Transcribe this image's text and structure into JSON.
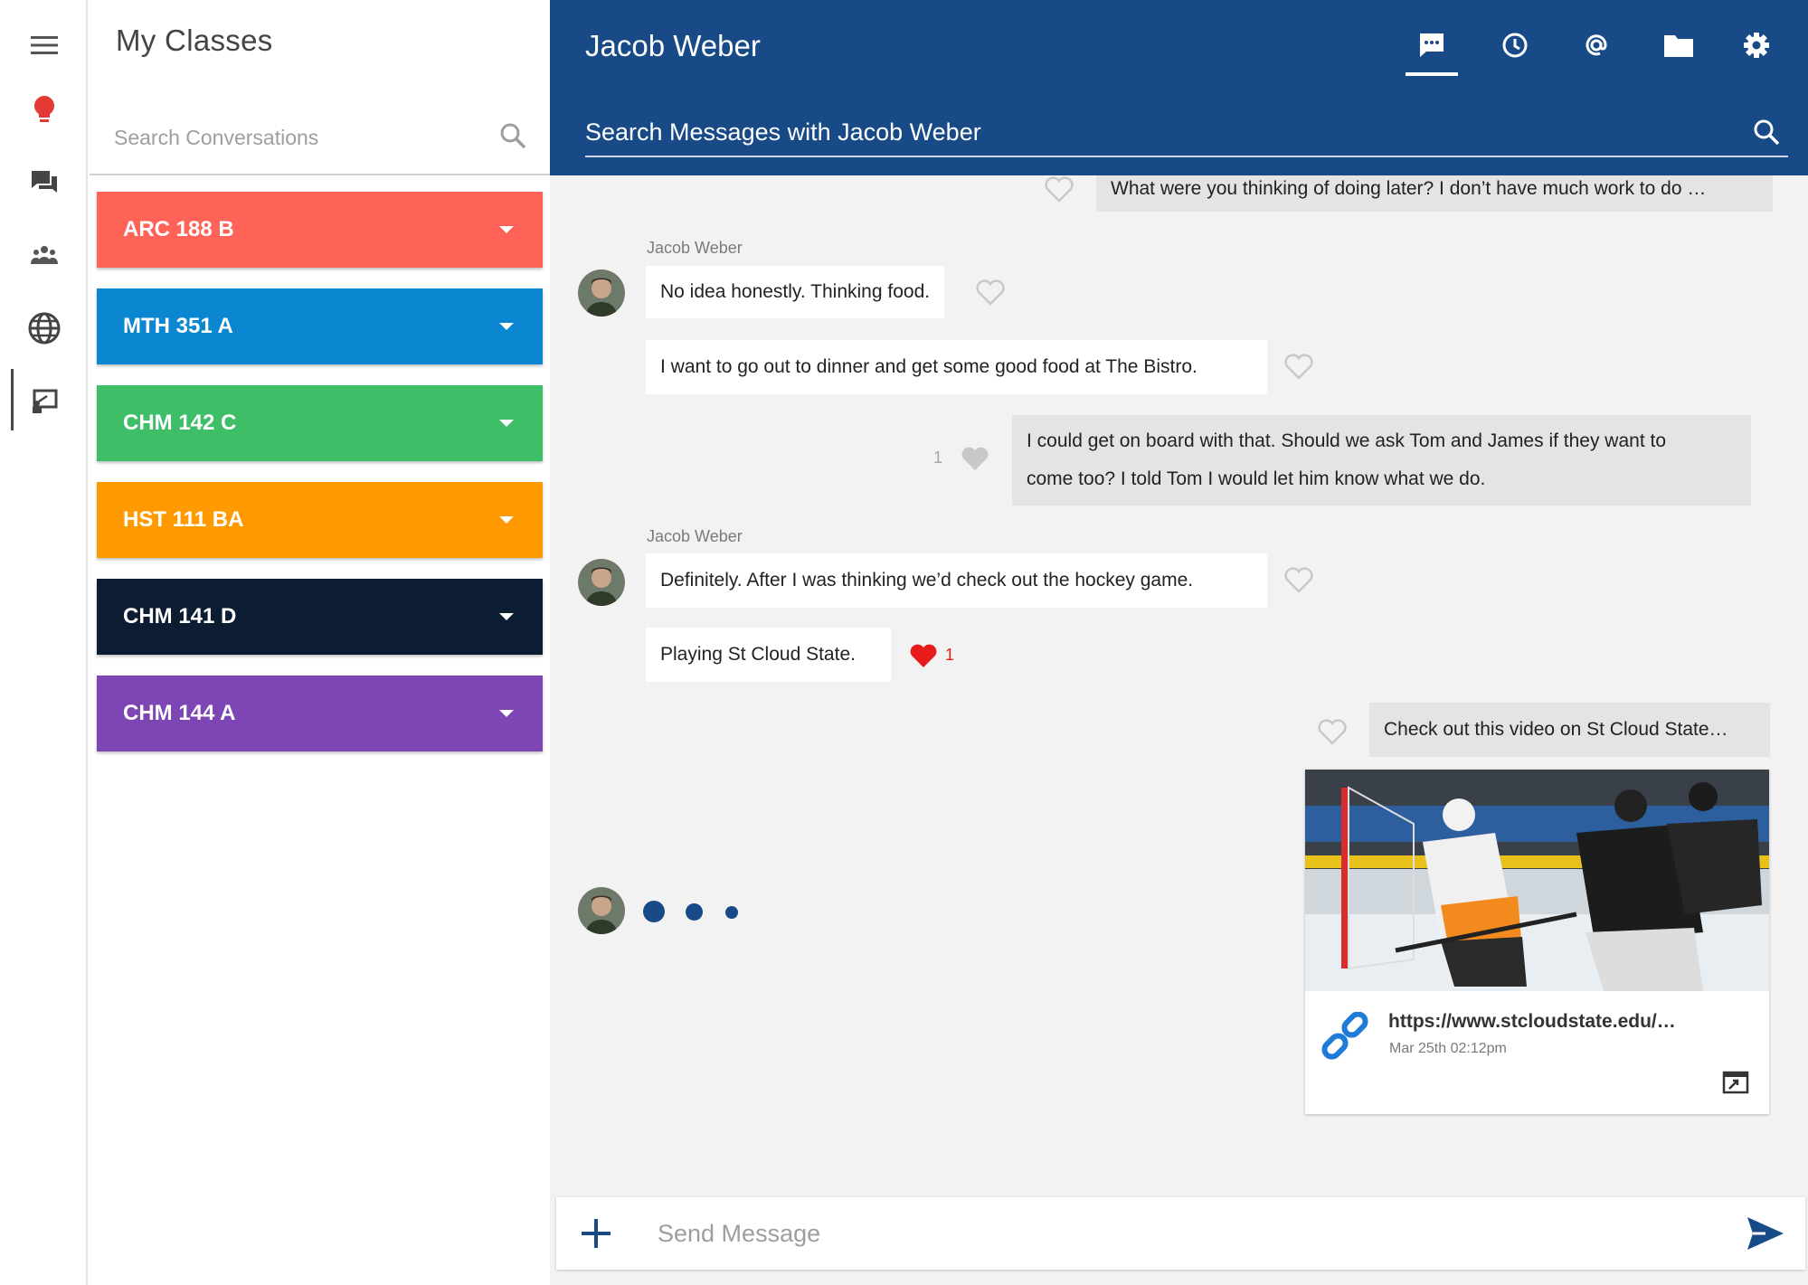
{
  "rail": {
    "items": [
      {
        "name": "menu-icon"
      },
      {
        "name": "lightbulb-icon",
        "color": "#e53935"
      },
      {
        "name": "chat-bubbles-icon"
      },
      {
        "name": "groups-icon"
      },
      {
        "name": "globe-icon"
      },
      {
        "name": "classroom-icon",
        "active": true
      }
    ]
  },
  "classes": {
    "title": "My Classes",
    "search_placeholder": "Search Conversations",
    "items": [
      {
        "label": "ARC 188 B",
        "color": "#ff6257"
      },
      {
        "label": "MTH 351 A",
        "color": "#0a87d0"
      },
      {
        "label": "CHM 142 C",
        "color": "#3ebe67"
      },
      {
        "label": "HST 111 BA",
        "color": "#ff9b00"
      },
      {
        "label": "CHM 141 D",
        "color": "#0c1d33"
      },
      {
        "label": "CHM 144 A",
        "color": "#7e45b5"
      }
    ]
  },
  "chat": {
    "title": "Jacob Weber",
    "header_icons": [
      "chat-icon",
      "history-icon",
      "mention-icon",
      "folder-icon",
      "settings-icon"
    ],
    "active_header_icon": "chat-icon",
    "search_placeholder": "Search Messages with Jacob Weber",
    "accent": "#174a87",
    "messages": {
      "m1": "What were you thinking of doing later? I don’t have much work to do …",
      "sender1": "Jacob Weber",
      "m2": "No idea honestly. Thinking food.",
      "m3": "I want to go out to dinner and get some good food at The Bistro.",
      "m4_line1": "I could get on board with that. Should we ask Tom and James if they want to",
      "m4_line2": "come too? I told Tom I would let him know what we do.",
      "m4_likes": "1",
      "sender2": "Jacob Weber",
      "m5": "Definitely. After I was thinking we’d check out the hockey game.",
      "m6": "Playing St Cloud State.",
      "m6_likes": "1",
      "m7": "Check out this video on St Cloud State…"
    },
    "link_preview": {
      "url": "https://www.stcloudstate.edu/…",
      "date": "Mar 25th 02:12pm"
    },
    "composer": {
      "placeholder": "Send Message"
    }
  }
}
